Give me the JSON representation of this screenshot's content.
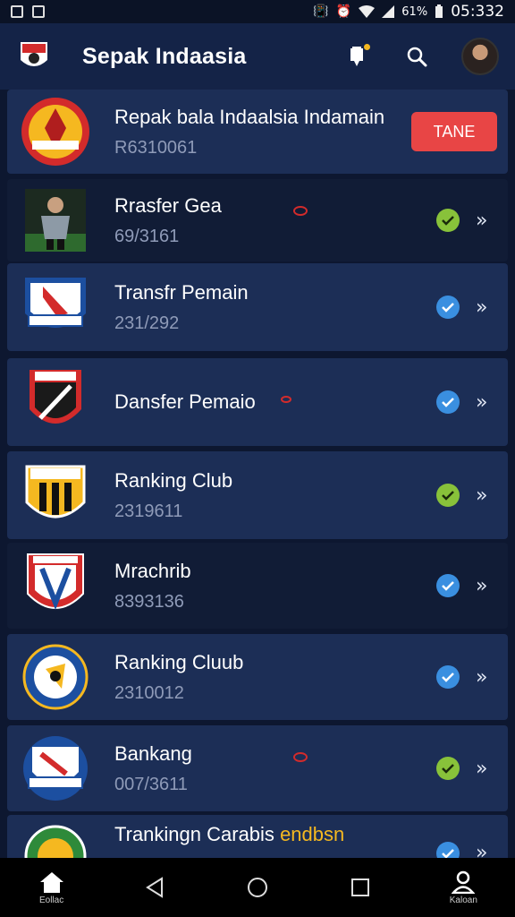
{
  "status_bar": {
    "battery": "61%",
    "time": "05:332",
    "icons": [
      "notification-icon",
      "image-icon",
      "vibrate-icon",
      "alarm-icon",
      "wifi-icon",
      "signal-icon",
      "battery-icon"
    ]
  },
  "app_bar": {
    "title": "Sepak Indaasia",
    "actions": [
      "notification-icon",
      "search-icon",
      "avatar"
    ]
  },
  "items": [
    {
      "title": "Repak bala Indaalsia Indamain",
      "subtitle": "R6310061",
      "crest": "garuda-crest",
      "action": "TANE",
      "action_color": "#e84545"
    },
    {
      "title": "Rrasfer Gea",
      "subtitle": "69/3161",
      "crest": "player-photo",
      "status": "green",
      "marker": true
    },
    {
      "title": "Transfr Pemain",
      "subtitle": "231/292",
      "crest": "shield-crest-blue",
      "status": "blue"
    },
    {
      "title": "Dansfer Pemaio",
      "subtitle": "",
      "crest": "shield-crest-red",
      "status": "blue",
      "marker": true
    },
    {
      "title": "Ranking Club",
      "subtitle": "2319611",
      "crest": "striped-crest",
      "status": "green"
    },
    {
      "title": "Mrachrib",
      "subtitle": "8393136",
      "crest": "red-shield-crest",
      "status": "blue"
    },
    {
      "title": "Ranking Cluub",
      "subtitle": "2310012",
      "crest": "round-blue-crest",
      "status": "blue"
    },
    {
      "title": "Bankang",
      "subtitle": "007/3611",
      "crest": "blue-white-crest",
      "status": "green",
      "marker": true
    },
    {
      "title": "Trankingn Carabis",
      "title_highlight": "endbsn",
      "subtitle": "",
      "crest": "green-crest",
      "status": "blue"
    }
  ],
  "bottom_nav": [
    {
      "label": "Eollac",
      "icon": "home-icon"
    },
    {
      "label": "",
      "icon": "back-icon"
    },
    {
      "label": "",
      "icon": "home-circle-icon"
    },
    {
      "label": "",
      "icon": "recents-icon"
    },
    {
      "label": "Kaloan",
      "icon": "profile-icon"
    }
  ]
}
